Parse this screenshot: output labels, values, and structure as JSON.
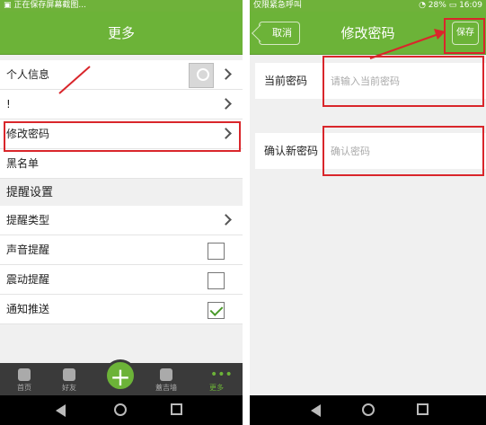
{
  "left": {
    "statusbar": {
      "text": "正在保存屏幕截图...",
      "time": ""
    },
    "title": "更多",
    "rows": [
      {
        "label": "个人信息"
      },
      {
        "label": "!"
      },
      {
        "label": "修改密码"
      },
      {
        "label": "黑名单"
      }
    ],
    "section_title": "提醒设置",
    "settings": [
      {
        "label": "提醒类型"
      },
      {
        "label": "声音提醒"
      },
      {
        "label": "震动提醒"
      },
      {
        "label": "通知推送"
      }
    ],
    "tabs": [
      {
        "label": "首页"
      },
      {
        "label": "好友"
      },
      {
        "label": ""
      },
      {
        "label": "蓋吉墙"
      },
      {
        "label": "更多"
      }
    ],
    "fab_label": "+"
  },
  "right": {
    "statusbar": {
      "text": "仅限紧急呼叫",
      "battery": "28%",
      "time": "16:09"
    },
    "back_label": "取消",
    "title": "修改密码",
    "save_label": "保存",
    "current_password": {
      "label": "当前密码",
      "placeholder": "请输入当前密码"
    },
    "confirm_password": {
      "label": "确认新密码",
      "placeholder": "确认密码"
    }
  },
  "colors": {
    "accent": "#6cb338",
    "highlight": "#d9262b"
  }
}
